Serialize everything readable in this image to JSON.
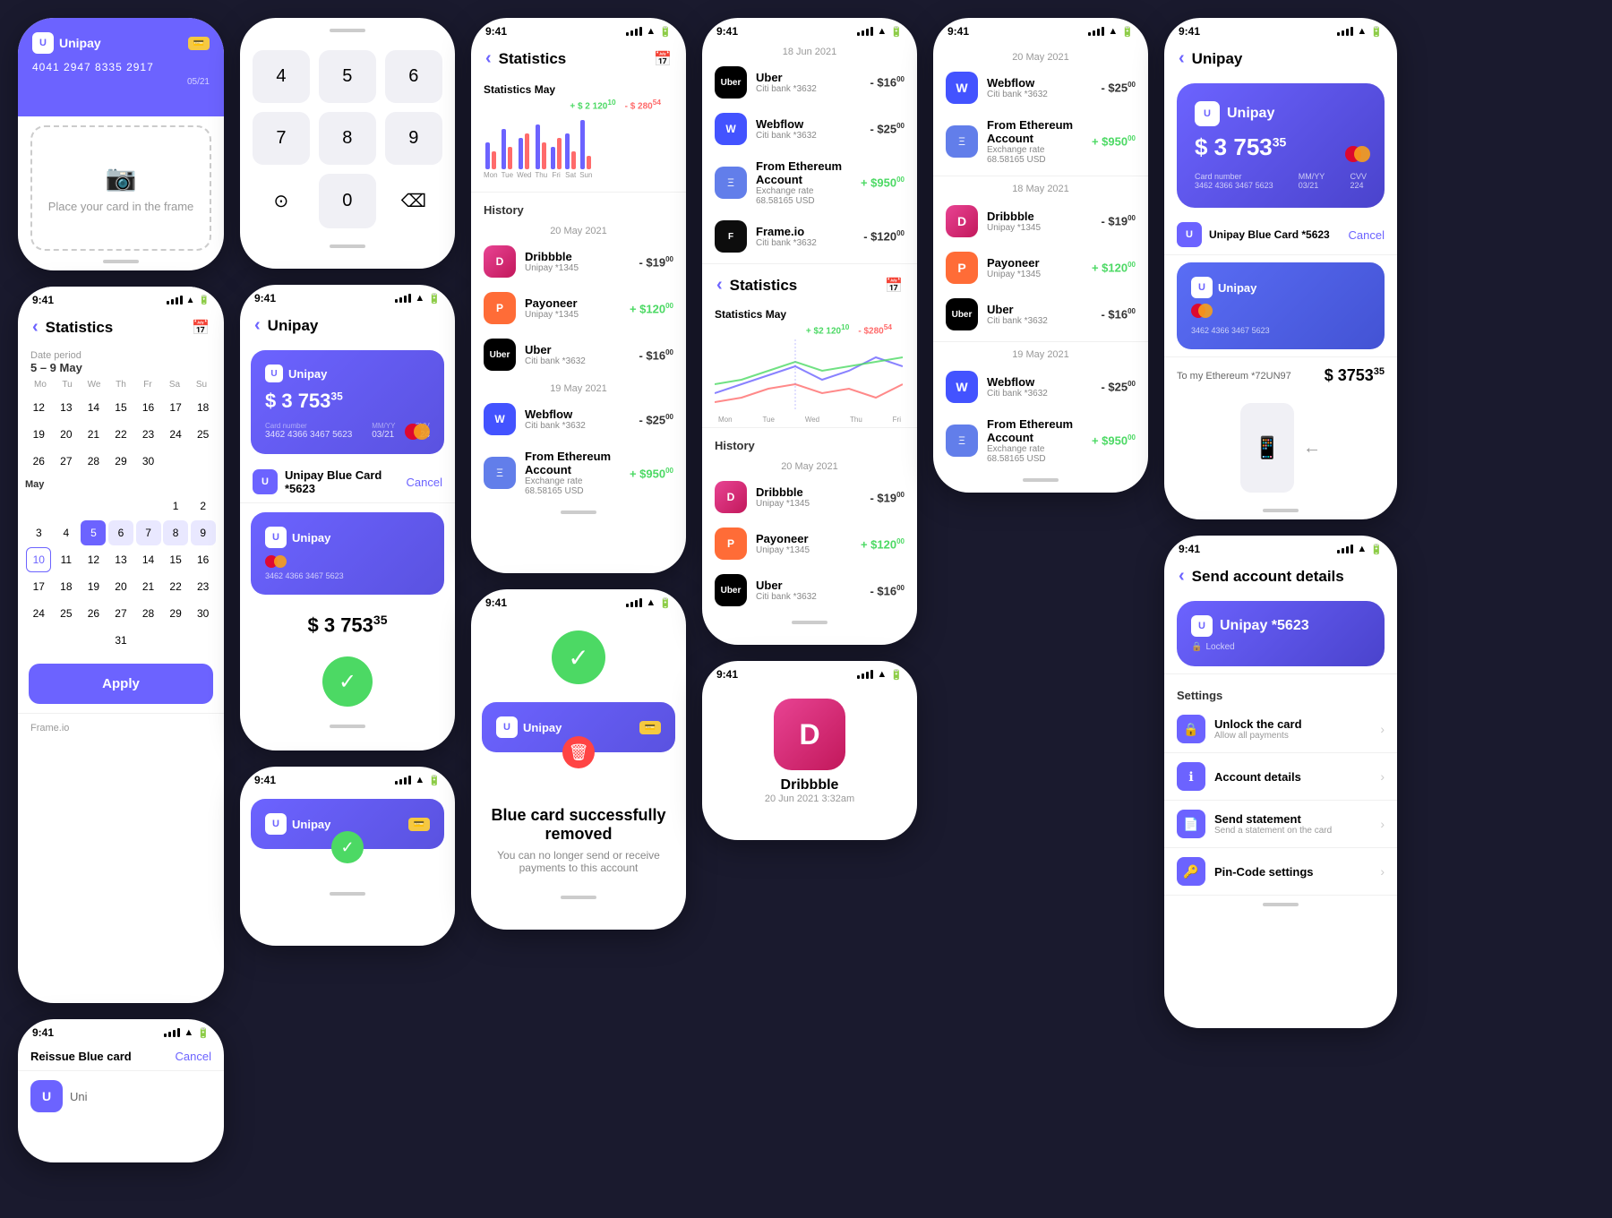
{
  "app": {
    "name": "Unipay",
    "time": "9:41",
    "card_number": "3462 4366 3467 5623",
    "card_expiry": "03/21",
    "card_cvv": "224",
    "balance": "$ 3 753",
    "balance_cents": "35",
    "card_id": "*5623",
    "card_label": "Unipay Blue Card *5623",
    "card_number_display": "4041 2947 8335 2917",
    "card_expiry_display": "05/21"
  },
  "statistics": {
    "title": "Statistics",
    "month": "May",
    "income": "+ $ 2 120",
    "income_cents": "10",
    "expense": "- $ 280",
    "expense_cents": "54",
    "days": [
      "Mon",
      "Tue",
      "Wed",
      "Thu",
      "Fri",
      "Sat",
      "Sun"
    ]
  },
  "history": {
    "title": "History",
    "date1": "20 May 2021",
    "date2": "19 May 2021",
    "date3": "18 Jun 2021",
    "transactions": [
      {
        "name": "Dribbble",
        "sub": "Unipay *1345",
        "amount": "- $19",
        "type": "neg",
        "icon": "D",
        "color": "#e84393"
      },
      {
        "name": "Payoneer",
        "sub": "Unipay *1345",
        "amount": "+ $120",
        "type": "pos",
        "icon": "P",
        "color": "#ff6c37"
      },
      {
        "name": "Uber",
        "sub": "Citi bank *3632",
        "amount": "- $16",
        "type": "neg",
        "icon": "U",
        "color": "#000"
      },
      {
        "name": "Webflow",
        "sub": "Citi bank *3632",
        "amount": "- $25",
        "type": "neg",
        "icon": "W",
        "color": "#4353ff"
      },
      {
        "name": "From Ethereum Account",
        "sub": "Exchange rate 68.58165 USD",
        "amount": "+ $950",
        "type": "pos",
        "icon": "Ξ",
        "color": "#627eea"
      },
      {
        "name": "Frame.io",
        "sub": "Citi bank *3632",
        "amount": "- $120",
        "type": "neg",
        "icon": "F",
        "color": "#0d0d0d"
      }
    ]
  },
  "calendar": {
    "date_period_label": "Date period",
    "date_range": "5 – 9 May",
    "months": [
      "May"
    ],
    "week_headers": [
      "Mo",
      "Tu",
      "We",
      "Th",
      "Fr",
      "Sa",
      "Su"
    ],
    "apply_label": "Apply",
    "weeks": [
      [
        {
          "d": "",
          "empty": true
        },
        {
          "d": "",
          "empty": true
        },
        {
          "d": "",
          "empty": true
        },
        {
          "d": "",
          "empty": true
        },
        {
          "d": "",
          "empty": true
        },
        {
          "d": "",
          "empty": true
        },
        {
          "d": "",
          "empty": true
        }
      ],
      [
        {
          "d": "12"
        },
        {
          "d": "13"
        },
        {
          "d": "14"
        },
        {
          "d": "15"
        },
        {
          "d": "16"
        },
        {
          "d": "17"
        },
        {
          "d": "18"
        }
      ],
      [
        {
          "d": "19"
        },
        {
          "d": "20"
        },
        {
          "d": "21"
        },
        {
          "d": "22"
        },
        {
          "d": "23"
        },
        {
          "d": "24"
        },
        {
          "d": "25"
        }
      ],
      [
        {
          "d": "26"
        },
        {
          "d": "27"
        },
        {
          "d": "28"
        },
        {
          "d": "29"
        },
        {
          "d": "30"
        },
        {
          "d": "",
          "empty": true
        },
        {
          "d": "",
          "empty": true
        }
      ],
      [
        {
          "d": "",
          "empty": true
        },
        {
          "d": "",
          "empty": true
        },
        {
          "d": "",
          "empty": true
        },
        {
          "d": "",
          "empty": true
        },
        {
          "d": "",
          "empty": true
        },
        {
          "d": "1"
        },
        {
          "d": "2"
        }
      ],
      [
        {
          "d": "3"
        },
        {
          "d": "4"
        },
        {
          "d": "5",
          "sel": true
        },
        {
          "d": "6",
          "range": true
        },
        {
          "d": "7",
          "range": true
        },
        {
          "d": "8",
          "range": true
        },
        {
          "d": "9",
          "range": true
        }
      ],
      [
        {
          "d": "10",
          "today": true
        },
        {
          "d": "11"
        },
        {
          "d": "12"
        },
        {
          "d": "13"
        },
        {
          "d": "14"
        },
        {
          "d": "15"
        },
        {
          "d": "16"
        }
      ],
      [
        {
          "d": "17"
        },
        {
          "d": "18"
        },
        {
          "d": "19"
        },
        {
          "d": "20"
        },
        {
          "d": "21"
        },
        {
          "d": "22"
        },
        {
          "d": "23"
        }
      ],
      [
        {
          "d": "24"
        },
        {
          "d": "25"
        },
        {
          "d": "26"
        },
        {
          "d": "27"
        },
        {
          "d": "28"
        },
        {
          "d": "29"
        },
        {
          "d": "30"
        }
      ],
      [
        {
          "d": "31"
        },
        {
          "d": "",
          "empty": true
        },
        {
          "d": "",
          "empty": true
        },
        {
          "d": "",
          "empty": true
        },
        {
          "d": "",
          "empty": true
        },
        {
          "d": "",
          "empty": true
        },
        {
          "d": "",
          "empty": true
        }
      ]
    ]
  },
  "keypad": {
    "keys": [
      "4",
      "5",
      "6",
      "7",
      "8",
      "9",
      "",
      "0",
      "⌫"
    ],
    "biometric": "⊙"
  },
  "send_account": {
    "title": "Send account details",
    "card_name": "Unipay *5623",
    "locked_text": "Locked",
    "settings_title": "Settings",
    "settings_items": [
      {
        "title": "Unlock the card",
        "sub": "Allow all payments",
        "icon": "🔒"
      },
      {
        "title": "Account details",
        "sub": "",
        "icon": "ℹ"
      },
      {
        "title": "Send statement",
        "sub": "Send a statement on the card",
        "icon": "📄"
      },
      {
        "title": "Pin-Code settings",
        "sub": "",
        "icon": "🔑"
      }
    ]
  },
  "card_removed": {
    "title": "Blue card successfully removed",
    "sub": "You can no longer send or receive payments to this account"
  },
  "reissue": {
    "title": "Reissue Blue card",
    "cancel": "Cancel"
  },
  "scan": {
    "label": "Place your card in the frame"
  },
  "dribbble_detail": {
    "name": "Dribbble",
    "date": "20 Jun 2021 3:32am"
  },
  "ethereum_account": {
    "title": "To my Ethereum *72UN97",
    "amount": "$ 3753",
    "cents": "35"
  }
}
